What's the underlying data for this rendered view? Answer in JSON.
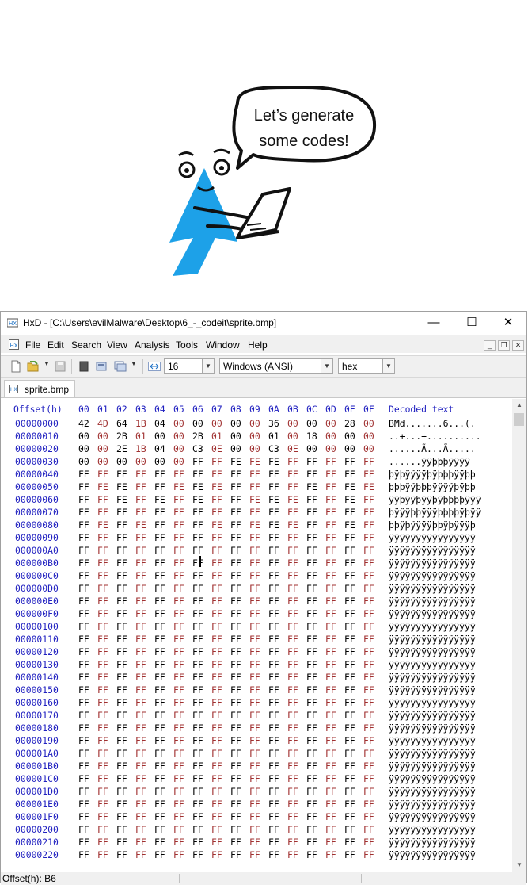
{
  "bubble": {
    "line1": "Let’s generate",
    "line2": "some codes!"
  },
  "window": {
    "title": "HxD - [C:\\Users\\evilMalware\\Desktop\\6_-_codeit\\sprite.bmp]",
    "minimize_glyph": "—",
    "maximize_glyph": "☐",
    "close_glyph": "✕"
  },
  "menu": [
    "File",
    "Edit",
    "Search",
    "View",
    "Analysis",
    "Tools",
    "Window",
    "Help"
  ],
  "toolbar": {
    "bytes_per_row": "16",
    "charset": "Windows (ANSI)",
    "display_mode": "hex"
  },
  "tab": {
    "label": "sprite.bmp"
  },
  "hex": {
    "offset_header": "Offset(h)",
    "columns": [
      "00",
      "01",
      "02",
      "03",
      "04",
      "05",
      "06",
      "07",
      "08",
      "09",
      "0A",
      "0B",
      "0C",
      "0D",
      "0E",
      "0F"
    ],
    "decoded_header": "Decoded text",
    "rows": [
      {
        "offset": "00000000",
        "bytes": [
          "42",
          "4D",
          "64",
          "1B",
          "04",
          "00",
          "00",
          "00",
          "00",
          "00",
          "36",
          "00",
          "00",
          "00",
          "28",
          "00"
        ],
        "text": "BMd.......6...(."
      },
      {
        "offset": "00000010",
        "bytes": [
          "00",
          "00",
          "2B",
          "01",
          "00",
          "00",
          "2B",
          "01",
          "00",
          "00",
          "01",
          "00",
          "18",
          "00",
          "00",
          "00"
        ],
        "text": "..+...+.........."
      },
      {
        "offset": "00000020",
        "bytes": [
          "00",
          "00",
          "2E",
          "1B",
          "04",
          "00",
          "C3",
          "0E",
          "00",
          "00",
          "C3",
          "0E",
          "00",
          "00",
          "00",
          "00"
        ],
        "text": "......Ã...Ã....."
      },
      {
        "offset": "00000030",
        "bytes": [
          "00",
          "00",
          "00",
          "00",
          "00",
          "00",
          "FF",
          "FF",
          "FE",
          "FE",
          "FE",
          "FF",
          "FF",
          "FF",
          "FF",
          "FF"
        ],
        "text": "......ÿÿþþþÿÿÿÿ"
      },
      {
        "offset": "00000040",
        "bytes": [
          "FE",
          "FF",
          "FE",
          "FF",
          "FF",
          "FF",
          "FF",
          "FE",
          "FF",
          "FE",
          "FE",
          "FE",
          "FF",
          "FF",
          "FE",
          "FE"
        ],
        "text": "þÿþÿÿÿÿþÿþþþÿÿþþ"
      },
      {
        "offset": "00000050",
        "bytes": [
          "FF",
          "FE",
          "FE",
          "FF",
          "FF",
          "FE",
          "FE",
          "FE",
          "FF",
          "FF",
          "FF",
          "FF",
          "FE",
          "FF",
          "FE",
          "FE"
        ],
        "text": "þþþÿÿþþþÿÿÿÿþÿþþ"
      },
      {
        "offset": "00000060",
        "bytes": [
          "FF",
          "FF",
          "FE",
          "FF",
          "FE",
          "FF",
          "FE",
          "FF",
          "FF",
          "FE",
          "FE",
          "FE",
          "FF",
          "FF",
          "FE",
          "FF"
        ],
        "text": "ÿÿþÿÿþÿÿþÿþþþþÿÿÿ"
      },
      {
        "offset": "00000070",
        "bytes": [
          "FE",
          "FF",
          "FF",
          "FF",
          "FE",
          "FE",
          "FF",
          "FF",
          "FF",
          "FE",
          "FE",
          "FE",
          "FF",
          "FE",
          "FF",
          "FF"
        ],
        "text": "þÿÿÿþþÿÿÿþþþþÿþÿÿ"
      },
      {
        "offset": "00000080",
        "bytes": [
          "FF",
          "FE",
          "FF",
          "FE",
          "FF",
          "FF",
          "FF",
          "FE",
          "FF",
          "FE",
          "FE",
          "FE",
          "FF",
          "FF",
          "FE",
          "FF"
        ],
        "text": "þþÿþÿÿÿÿþþÿþÿÿÿþ"
      },
      {
        "offset": "00000090",
        "bytes": [
          "FF",
          "FF",
          "FF",
          "FF",
          "FF",
          "FF",
          "FF",
          "FF",
          "FF",
          "FF",
          "FF",
          "FF",
          "FF",
          "FF",
          "FF",
          "FF"
        ],
        "text": "ÿÿÿÿÿÿÿÿÿÿÿÿÿÿÿÿ"
      },
      {
        "offset": "000000A0",
        "bytes": [
          "FF",
          "FF",
          "FF",
          "FF",
          "FF",
          "FF",
          "FF",
          "FF",
          "FF",
          "FF",
          "FF",
          "FF",
          "FF",
          "FF",
          "FF",
          "FF"
        ],
        "text": "ÿÿÿÿÿÿÿÿÿÿÿÿÿÿÿÿ"
      },
      {
        "offset": "000000B0",
        "bytes": [
          "FF",
          "FF",
          "FF",
          "FF",
          "FF",
          "FF",
          "FF",
          "FF",
          "FF",
          "FF",
          "FF",
          "FF",
          "FF",
          "FF",
          "FF",
          "FF"
        ],
        "text": "ÿÿÿÿÿÿÿÿÿÿÿÿÿÿÿÿ"
      },
      {
        "offset": "000000C0",
        "bytes": [
          "FF",
          "FF",
          "FF",
          "FF",
          "FF",
          "FF",
          "FF",
          "FF",
          "FF",
          "FF",
          "FF",
          "FF",
          "FF",
          "FF",
          "FF",
          "FF"
        ],
        "text": "ÿÿÿÿÿÿÿÿÿÿÿÿÿÿÿÿ"
      },
      {
        "offset": "000000D0",
        "bytes": [
          "FF",
          "FF",
          "FF",
          "FF",
          "FF",
          "FF",
          "FF",
          "FF",
          "FF",
          "FF",
          "FF",
          "FF",
          "FF",
          "FF",
          "FF",
          "FF"
        ],
        "text": "ÿÿÿÿÿÿÿÿÿÿÿÿÿÿÿÿ"
      },
      {
        "offset": "000000E0",
        "bytes": [
          "FF",
          "FF",
          "FF",
          "FF",
          "FF",
          "FF",
          "FF",
          "FF",
          "FF",
          "FF",
          "FF",
          "FF",
          "FF",
          "FF",
          "FF",
          "FF"
        ],
        "text": "ÿÿÿÿÿÿÿÿÿÿÿÿÿÿÿÿ"
      },
      {
        "offset": "000000F0",
        "bytes": [
          "FF",
          "FF",
          "FF",
          "FF",
          "FF",
          "FF",
          "FF",
          "FF",
          "FF",
          "FF",
          "FF",
          "FF",
          "FF",
          "FF",
          "FF",
          "FF"
        ],
        "text": "ÿÿÿÿÿÿÿÿÿÿÿÿÿÿÿÿ"
      },
      {
        "offset": "00000100",
        "bytes": [
          "FF",
          "FF",
          "FF",
          "FF",
          "FF",
          "FF",
          "FF",
          "FF",
          "FF",
          "FF",
          "FF",
          "FF",
          "FF",
          "FF",
          "FF",
          "FF"
        ],
        "text": "ÿÿÿÿÿÿÿÿÿÿÿÿÿÿÿÿ"
      },
      {
        "offset": "00000110",
        "bytes": [
          "FF",
          "FF",
          "FF",
          "FF",
          "FF",
          "FF",
          "FF",
          "FF",
          "FF",
          "FF",
          "FF",
          "FF",
          "FF",
          "FF",
          "FF",
          "FF"
        ],
        "text": "ÿÿÿÿÿÿÿÿÿÿÿÿÿÿÿÿ"
      },
      {
        "offset": "00000120",
        "bytes": [
          "FF",
          "FF",
          "FF",
          "FF",
          "FF",
          "FF",
          "FF",
          "FF",
          "FF",
          "FF",
          "FF",
          "FF",
          "FF",
          "FF",
          "FF",
          "FF"
        ],
        "text": "ÿÿÿÿÿÿÿÿÿÿÿÿÿÿÿÿ"
      },
      {
        "offset": "00000130",
        "bytes": [
          "FF",
          "FF",
          "FF",
          "FF",
          "FF",
          "FF",
          "FF",
          "FF",
          "FF",
          "FF",
          "FF",
          "FF",
          "FF",
          "FF",
          "FF",
          "FF"
        ],
        "text": "ÿÿÿÿÿÿÿÿÿÿÿÿÿÿÿÿ"
      },
      {
        "offset": "00000140",
        "bytes": [
          "FF",
          "FF",
          "FF",
          "FF",
          "FF",
          "FF",
          "FF",
          "FF",
          "FF",
          "FF",
          "FF",
          "FF",
          "FF",
          "FF",
          "FF",
          "FF"
        ],
        "text": "ÿÿÿÿÿÿÿÿÿÿÿÿÿÿÿÿ"
      },
      {
        "offset": "00000150",
        "bytes": [
          "FF",
          "FF",
          "FF",
          "FF",
          "FF",
          "FF",
          "FF",
          "FF",
          "FF",
          "FF",
          "FF",
          "FF",
          "FF",
          "FF",
          "FF",
          "FF"
        ],
        "text": "ÿÿÿÿÿÿÿÿÿÿÿÿÿÿÿÿ"
      },
      {
        "offset": "00000160",
        "bytes": [
          "FF",
          "FF",
          "FF",
          "FF",
          "FF",
          "FF",
          "FF",
          "FF",
          "FF",
          "FF",
          "FF",
          "FF",
          "FF",
          "FF",
          "FF",
          "FF"
        ],
        "text": "ÿÿÿÿÿÿÿÿÿÿÿÿÿÿÿÿ"
      },
      {
        "offset": "00000170",
        "bytes": [
          "FF",
          "FF",
          "FF",
          "FF",
          "FF",
          "FF",
          "FF",
          "FF",
          "FF",
          "FF",
          "FF",
          "FF",
          "FF",
          "FF",
          "FF",
          "FF"
        ],
        "text": "ÿÿÿÿÿÿÿÿÿÿÿÿÿÿÿÿ"
      },
      {
        "offset": "00000180",
        "bytes": [
          "FF",
          "FF",
          "FF",
          "FF",
          "FF",
          "FF",
          "FF",
          "FF",
          "FF",
          "FF",
          "FF",
          "FF",
          "FF",
          "FF",
          "FF",
          "FF"
        ],
        "text": "ÿÿÿÿÿÿÿÿÿÿÿÿÿÿÿÿ"
      },
      {
        "offset": "00000190",
        "bytes": [
          "FF",
          "FF",
          "FF",
          "FF",
          "FF",
          "FF",
          "FF",
          "FF",
          "FF",
          "FF",
          "FF",
          "FF",
          "FF",
          "FF",
          "FF",
          "FF"
        ],
        "text": "ÿÿÿÿÿÿÿÿÿÿÿÿÿÿÿÿ"
      },
      {
        "offset": "000001A0",
        "bytes": [
          "FF",
          "FF",
          "FF",
          "FF",
          "FF",
          "FF",
          "FF",
          "FF",
          "FF",
          "FF",
          "FF",
          "FF",
          "FF",
          "FF",
          "FF",
          "FF"
        ],
        "text": "ÿÿÿÿÿÿÿÿÿÿÿÿÿÿÿÿ"
      },
      {
        "offset": "000001B0",
        "bytes": [
          "FF",
          "FF",
          "FF",
          "FF",
          "FF",
          "FF",
          "FF",
          "FF",
          "FF",
          "FF",
          "FF",
          "FF",
          "FF",
          "FF",
          "FF",
          "FF"
        ],
        "text": "ÿÿÿÿÿÿÿÿÿÿÿÿÿÿÿÿ"
      },
      {
        "offset": "000001C0",
        "bytes": [
          "FF",
          "FF",
          "FF",
          "FF",
          "FF",
          "FF",
          "FF",
          "FF",
          "FF",
          "FF",
          "FF",
          "FF",
          "FF",
          "FF",
          "FF",
          "FF"
        ],
        "text": "ÿÿÿÿÿÿÿÿÿÿÿÿÿÿÿÿ"
      },
      {
        "offset": "000001D0",
        "bytes": [
          "FF",
          "FF",
          "FF",
          "FF",
          "FF",
          "FF",
          "FF",
          "FF",
          "FF",
          "FF",
          "FF",
          "FF",
          "FF",
          "FF",
          "FF",
          "FF"
        ],
        "text": "ÿÿÿÿÿÿÿÿÿÿÿÿÿÿÿÿ"
      },
      {
        "offset": "000001E0",
        "bytes": [
          "FF",
          "FF",
          "FF",
          "FF",
          "FF",
          "FF",
          "FF",
          "FF",
          "FF",
          "FF",
          "FF",
          "FF",
          "FF",
          "FF",
          "FF",
          "FF"
        ],
        "text": "ÿÿÿÿÿÿÿÿÿÿÿÿÿÿÿÿ"
      },
      {
        "offset": "000001F0",
        "bytes": [
          "FF",
          "FF",
          "FF",
          "FF",
          "FF",
          "FF",
          "FF",
          "FF",
          "FF",
          "FF",
          "FF",
          "FF",
          "FF",
          "FF",
          "FF",
          "FF"
        ],
        "text": "ÿÿÿÿÿÿÿÿÿÿÿÿÿÿÿÿ"
      },
      {
        "offset": "00000200",
        "bytes": [
          "FF",
          "FF",
          "FF",
          "FF",
          "FF",
          "FF",
          "FF",
          "FF",
          "FF",
          "FF",
          "FF",
          "FF",
          "FF",
          "FF",
          "FF",
          "FF"
        ],
        "text": "ÿÿÿÿÿÿÿÿÿÿÿÿÿÿÿÿ"
      },
      {
        "offset": "00000210",
        "bytes": [
          "FF",
          "FF",
          "FF",
          "FF",
          "FF",
          "FF",
          "FF",
          "FF",
          "FF",
          "FF",
          "FF",
          "FF",
          "FF",
          "FF",
          "FF",
          "FF"
        ],
        "text": "ÿÿÿÿÿÿÿÿÿÿÿÿÿÿÿÿ"
      },
      {
        "offset": "00000220",
        "bytes": [
          "FF",
          "FF",
          "FF",
          "FF",
          "FF",
          "FF",
          "FF",
          "FF",
          "FF",
          "FF",
          "FF",
          "FF",
          "FF",
          "FF",
          "FF",
          "FF"
        ],
        "text": "ÿÿÿÿÿÿÿÿÿÿÿÿÿÿÿÿ"
      }
    ]
  },
  "status": {
    "text": "Offset(h): B6"
  },
  "colors": {
    "mascot_blue": "#1da1e8",
    "offset_blue": "#2020c0",
    "odd_column_red": "#a03030"
  },
  "icons": {
    "app": "hxd-app-icon",
    "new": "new-file-icon",
    "open": "open-folder-icon",
    "save": "save-icon",
    "close_file": "close-file-icon",
    "properties": "properties-icon",
    "windows": "windows-icon",
    "offset_arrows": "offset-arrows-icon",
    "tab": "file-tab-icon"
  }
}
